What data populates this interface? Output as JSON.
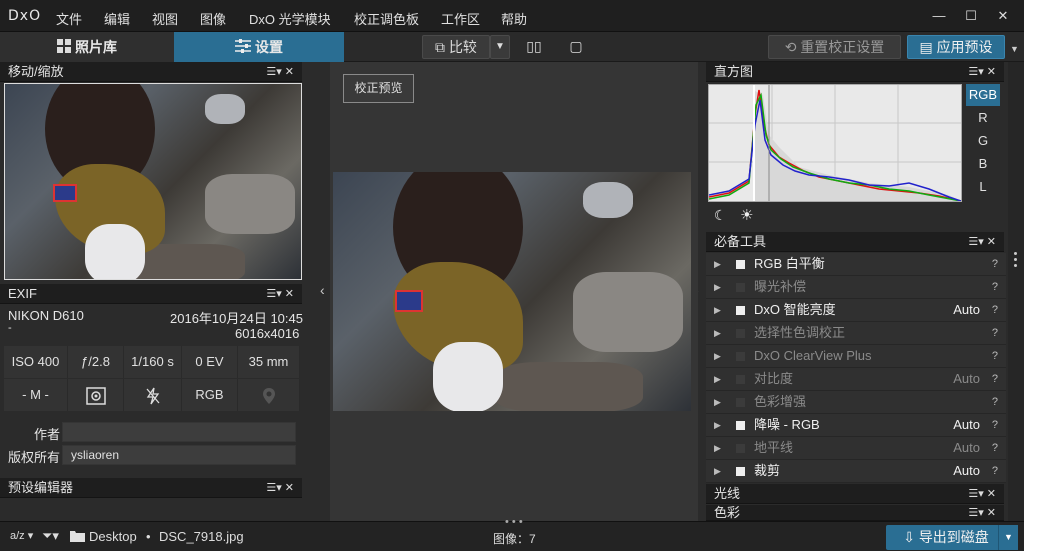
{
  "app": {
    "logo": "DxO",
    "menu": [
      "文件",
      "编辑",
      "视图",
      "图像",
      "DxO 光学模块",
      "校正调色板",
      "工作区",
      "帮助"
    ],
    "window_controls": [
      "—",
      "☐",
      "✕"
    ]
  },
  "toolbar": {
    "tabs": [
      {
        "label": "照片库",
        "icon": "grid-icon"
      },
      {
        "label": "设置",
        "icon": "sliders-icon"
      }
    ],
    "compare_label": "比较",
    "reset_label": "重置校正设置",
    "apply_preset_label": "应用预设"
  },
  "left": {
    "navigator_title": "移动/缩放",
    "exif": {
      "title": "EXIF",
      "camera": "NIKON D610",
      "date": "2016年10月24日 10:45",
      "lens": "-",
      "dimensions": "6016x4016",
      "row1": [
        "ISO 400",
        "ƒ/2.8",
        "1/160 s",
        "0 EV",
        "35 mm"
      ],
      "mode": "- M -",
      "color_space": "RGB",
      "author_label": "作者",
      "author_value": "",
      "copyright_label": "版权所有",
      "copyright_value": "ysliaoren"
    },
    "preset_editor_title": "预设编辑器"
  },
  "center": {
    "preview_button": "校正预览"
  },
  "right": {
    "histogram_title": "直方图",
    "channels": [
      "RGB",
      "R",
      "G",
      "B",
      "L"
    ],
    "selected_channel": "RGB",
    "essential_title": "必备工具",
    "tools": [
      {
        "label": "RGB 白平衡",
        "on": true,
        "auto": ""
      },
      {
        "label": "曝光补偿",
        "on": false,
        "auto": ""
      },
      {
        "label": "DxO 智能亮度",
        "on": true,
        "auto": "Auto"
      },
      {
        "label": "选择性色调校正",
        "on": false,
        "auto": ""
      },
      {
        "label": "DxO ClearView Plus",
        "on": false,
        "auto": ""
      },
      {
        "label": "对比度",
        "on": false,
        "auto": "Auto"
      },
      {
        "label": "色彩增强",
        "on": false,
        "auto": ""
      },
      {
        "label": "降噪 - RGB",
        "on": true,
        "auto": "Auto"
      },
      {
        "label": "地平线",
        "on": false,
        "auto": "Auto"
      },
      {
        "label": "裁剪",
        "on": true,
        "auto": "Auto"
      }
    ],
    "help_mark": "?",
    "light_title": "光线",
    "color_title": "色彩"
  },
  "status": {
    "sort_label": "a/z",
    "folder": "Desktop",
    "filename": "DSC_7918.jpg",
    "image_count": "图像：7",
    "export_label": "导出到磁盘"
  },
  "colors": {
    "accent": "#2a6e93",
    "panel_bg": "#2b2b2b",
    "header_bg": "#1e1e1e"
  }
}
